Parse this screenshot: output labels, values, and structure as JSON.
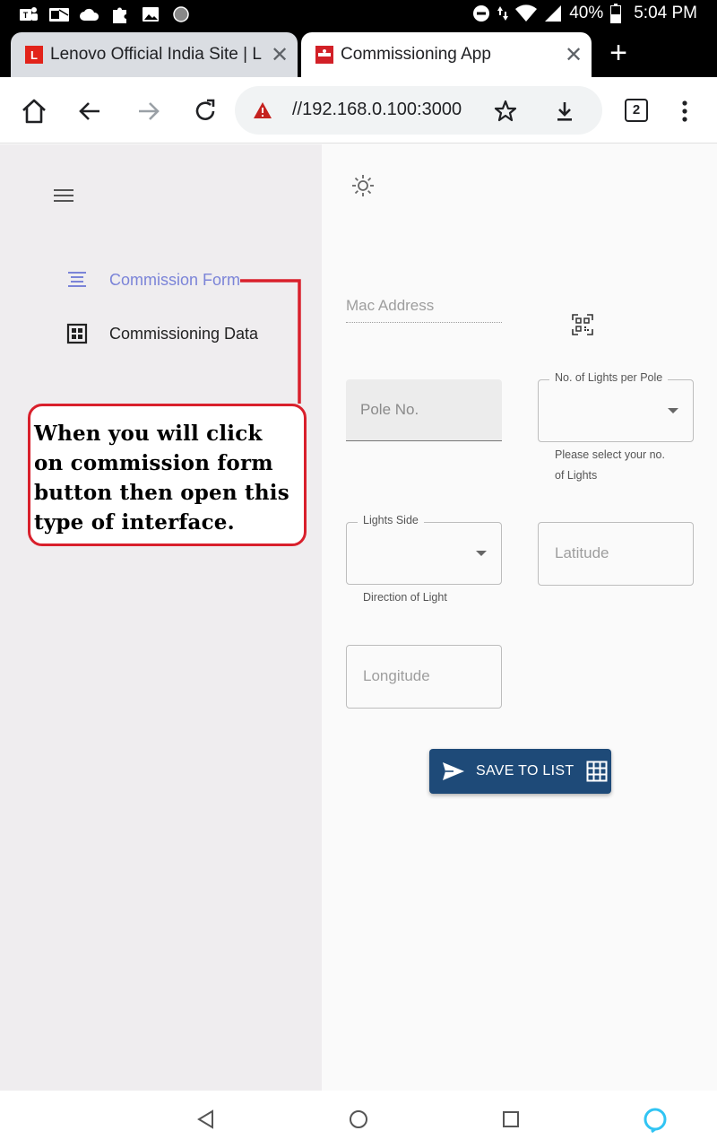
{
  "status_bar": {
    "battery": "40%",
    "time": "5:04 PM"
  },
  "tabs": [
    {
      "title": "Lenovo Official India Site | Lap",
      "close": "✕",
      "active": false
    },
    {
      "title": "Commissioning App",
      "close": "✕",
      "active": true
    }
  ],
  "new_tab": "+",
  "toolbar": {
    "url": "//192.168.0.100:3000",
    "tab_count": "2"
  },
  "sidebar": {
    "items": [
      {
        "label": "Commission Form",
        "icon": "align-center-icon",
        "selected": true
      },
      {
        "label": "Commissioning Data",
        "icon": "grid-icon",
        "selected": false
      }
    ]
  },
  "annotation": {
    "text": "When you will click\non commission form\nbutton then open this\ntype of interface."
  },
  "form": {
    "mac_address_placeholder": "Mac Address",
    "pole_no_placeholder": "Pole No.",
    "lights_per_pole_label": "No. of Lights per Pole",
    "lights_per_pole_helper": "Please select your no.\nof Lights",
    "lights_side_label": "Lights Side",
    "lights_side_helper": "Direction of Light",
    "latitude_placeholder": "Latitude",
    "longitude_placeholder": "Longitude",
    "save_label": "SAVE TO LIST"
  },
  "colors": {
    "accent": "#7b84d8",
    "button": "#1e4a78",
    "annotation": "#d9202c",
    "sidebar_bg": "#efedef"
  }
}
